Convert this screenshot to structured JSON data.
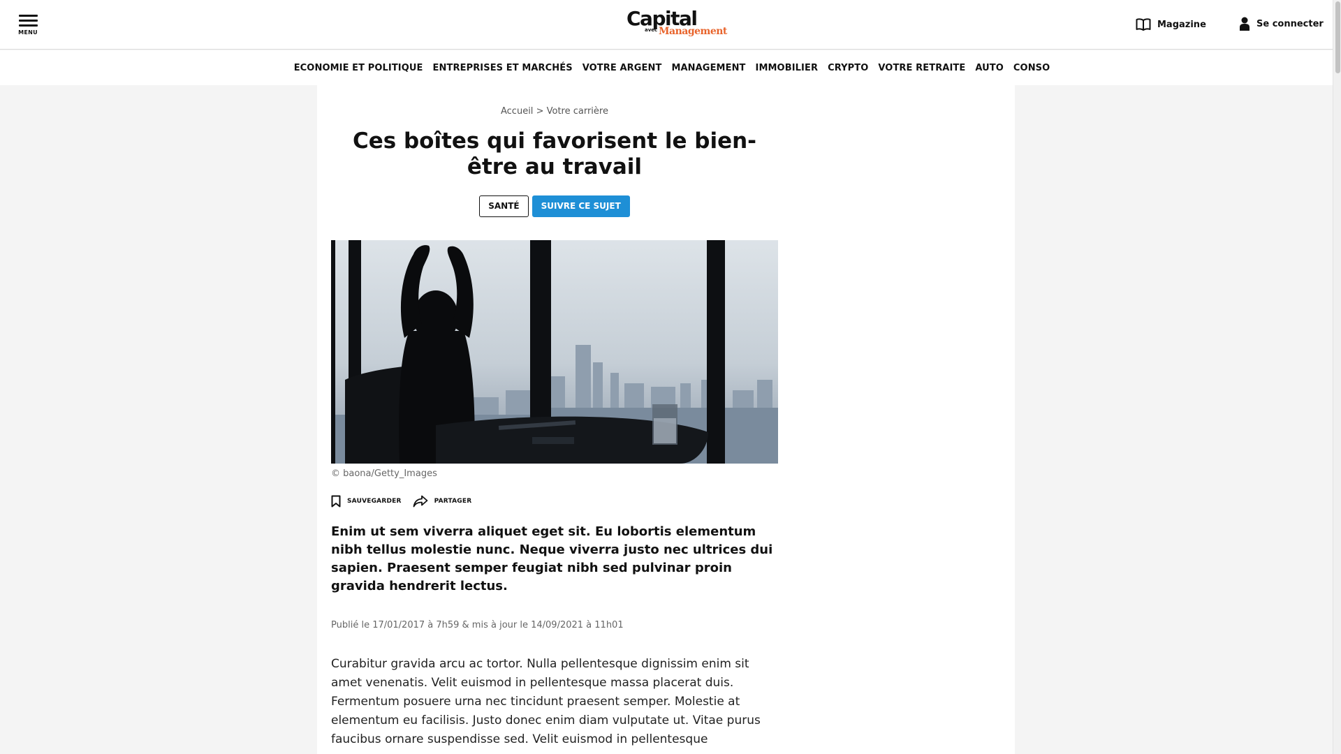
{
  "header": {
    "menu_label": "MENU",
    "logo_main": "Capital",
    "logo_small": "avec",
    "logo_accent": "Management",
    "magazine_label": "Magazine",
    "login_label": "Se connecter"
  },
  "nav": {
    "items": [
      "ECONOMIE ET POLITIQUE",
      "ENTREPRISES ET MARCHÉS",
      "VOTRE ARGENT",
      "MANAGEMENT",
      "IMMOBILIER",
      "CRYPTO",
      "VOTRE RETRAITE",
      "AUTO",
      "CONSO"
    ]
  },
  "breadcrumb": {
    "home": "Accueil",
    "separator": ">",
    "section": "Votre carrière"
  },
  "article": {
    "title": "Ces boîtes qui favorisent le bien-être au travail",
    "tag_label": "SANTÉ",
    "follow_label": "SUIVRE CE SUJET",
    "photo_credit": "© baona/Getty_Images",
    "save_label": "SAUVEGARDER",
    "share_label": "PARTAGER",
    "lead": "Enim ut sem viverra aliquet eget sit. Eu lobortis elementum nibh tellus molestie nunc. Neque viverra justo nec ultrices dui sapien. Praesent semper feugiat nibh sed pulvinar proin gravida hendrerit lectus.",
    "published": "Publié le 17/01/2017 à 7h59 & mis à jour le 14/09/2021 à 11h01",
    "body": "Curabitur gravida arcu ac tortor. Nulla pellentesque dignissim enim sit amet venenatis. Velit euismod in pellentesque massa placerat duis. Fermentum posuere urna nec tincidunt praesent semper. Molestie at elementum eu facilisis. Justo donec enim diam vulputate ut. Vitae purus faucibus ornare suspendisse sed. Velit euismod in pellentesque"
  },
  "colors": {
    "accent_orange": "#e8642c",
    "follow_blue": "#1e8fd6",
    "page_bg": "#f4f4f4"
  },
  "icons": {
    "menu": "hamburger-icon",
    "magazine": "open-book-icon",
    "login": "user-icon",
    "save": "bookmark-icon",
    "share": "share-arrow-icon"
  }
}
